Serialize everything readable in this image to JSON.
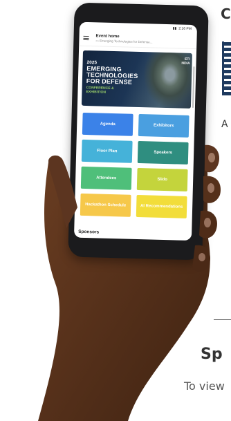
{
  "page_text": {
    "heading_fragment": "C",
    "paragraph_fragment": "A",
    "section_heading": "Sp",
    "section_body": "To view"
  },
  "phone": {
    "status_time": "2:16 PM",
    "appbar": {
      "title": "Event home",
      "subtitle": "Emerging Technologies for Defense..."
    },
    "banner": {
      "year": "2025",
      "line1": "EMERGING",
      "line2": "TECHNOLOGIES",
      "line3": "FOR DEFENSE",
      "conf1": "CONFERENCE &",
      "conf2": "EXHIBITION",
      "logo1": "ETI",
      "logo2": "NDIA"
    },
    "tiles": [
      {
        "label": "Agenda",
        "color": "#3b82e8"
      },
      {
        "label": "Exhibitors",
        "color": "#4a9fe0"
      },
      {
        "label": "Floor Plan",
        "color": "#45b2d9"
      },
      {
        "label": "Speakers",
        "color": "#2f8e80"
      },
      {
        "label": "Attendees",
        "color": "#4fbf7a"
      },
      {
        "label": "Slido",
        "color": "#c4d43c"
      },
      {
        "label": "Hackathon Schedule",
        "color": "#f6c84a"
      },
      {
        "label": "AI Recommendations",
        "color": "#f2dd3a"
      }
    ],
    "sponsors_label": "Sponsors"
  }
}
